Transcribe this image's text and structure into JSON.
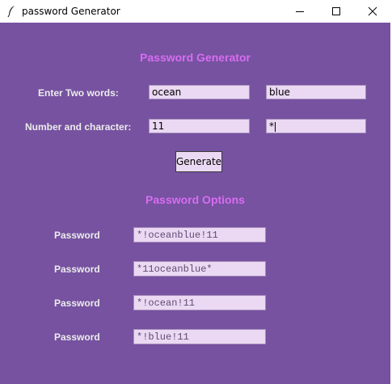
{
  "window": {
    "title": "password Generator",
    "icons": {
      "app": "feather-icon",
      "minimize": "minimize-icon",
      "maximize": "maximize-icon",
      "close": "close-icon"
    }
  },
  "form": {
    "heading": "Password Generator",
    "words_label": "Enter Two words:",
    "word1": "ocean",
    "word2": "blue",
    "numchar_label": "Number and character:",
    "number": "11",
    "character": "*",
    "generate_label": "Generate"
  },
  "options": {
    "heading": "Password Options",
    "items": [
      {
        "label": "Password",
        "value": "*!oceanblue!11"
      },
      {
        "label": "Password",
        "value": "*11oceanblue*"
      },
      {
        "label": "Password",
        "value": "*!ocean!11"
      },
      {
        "label": "Password",
        "value": "*!blue!11"
      }
    ]
  },
  "colors": {
    "background": "#7652a0",
    "heading": "#d86cf2",
    "label": "#ececec",
    "entry_bg": "#ebd9f3"
  }
}
